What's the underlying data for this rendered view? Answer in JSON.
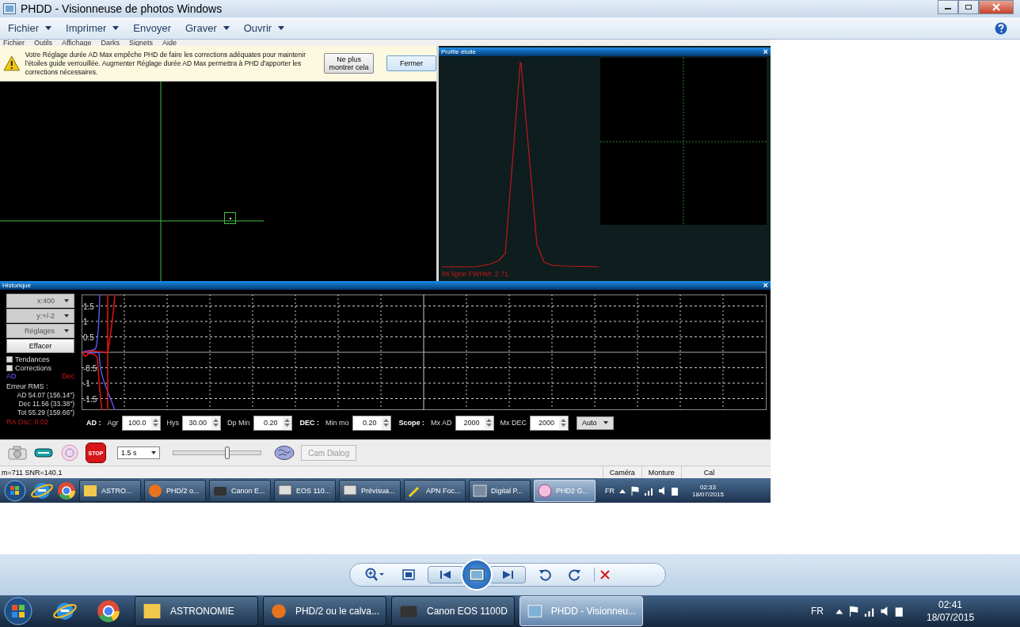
{
  "window": {
    "title": "PHDD - Visionneuse de photos Windows"
  },
  "toolbar": {
    "menus": [
      {
        "label": "Fichier",
        "has_menu": true
      },
      {
        "label": "Imprimer",
        "has_menu": true
      },
      {
        "label": "Envoyer",
        "has_menu": false
      },
      {
        "label": "Graver",
        "has_menu": true
      },
      {
        "label": "Ouvrir",
        "has_menu": true
      }
    ]
  },
  "screenshot": {
    "menu": [
      "Fichier",
      "Outils",
      "Affichage",
      "Darks",
      "Signets",
      "Aide"
    ],
    "alert": {
      "message": "Votre Réglage durée AD Max empêche PHD de faire les corrections adéquates pour maintenir l'étoiles guide verrouillée. Augmenter Réglage durée AD Max permettra à PHD d'apporter les corrections nécessaires.",
      "buttons": [
        "Ne plus montrer cela",
        "Fermer"
      ]
    },
    "profile": {
      "title": "Profile étoile",
      "close": "×",
      "readout": "Mi ligne FWHM: 2.71"
    },
    "history": {
      "title": "Historique",
      "close": "×",
      "dropdowns": [
        "x:400",
        "y:+/-2",
        "Réglages"
      ],
      "clear_button": "Effacer",
      "checkboxes": [
        {
          "label": "Tendances",
          "checked": false
        },
        {
          "label": "Corrections",
          "checked": false
        }
      ],
      "legend": {
        "ra": "AD",
        "dec": "Dec"
      },
      "rms_title": "Erreur RMS :",
      "rms": [
        "AD 54.07 (156.14\")",
        "Dec 11.56 (33.38\")",
        "Tot 55.29 (159.66\")"
      ],
      "osc": "RA Osc: 0.02",
      "yticks": [
        "1.5",
        "1",
        "0.5",
        "-0.5",
        "-1",
        "-1.5"
      ],
      "params": [
        {
          "kind": "heading",
          "text": "AD :"
        },
        {
          "kind": "spin",
          "label": "Agr",
          "value": "100.0"
        },
        {
          "kind": "spin",
          "label": "Hys",
          "value": "30.00"
        },
        {
          "kind": "spin",
          "label": "Dp Min",
          "value": "0.20"
        },
        {
          "kind": "heading",
          "text": "DEC :"
        },
        {
          "kind": "spin",
          "label": "Min mo",
          "value": "0.20"
        },
        {
          "kind": "heading",
          "text": "Scope :"
        },
        {
          "kind": "spin",
          "label": "Mx AD",
          "value": "2000"
        },
        {
          "kind": "spin",
          "label": "Mx DEC",
          "value": "2000"
        },
        {
          "kind": "select",
          "value": "Auto"
        }
      ]
    },
    "controls": {
      "stop_label": "STOP",
      "exposure": "1.5 s",
      "slider": {
        "level": 0.62
      },
      "cam_dialog": {
        "label": "Cam Dialog",
        "disabled": true
      }
    },
    "status": {
      "text": "m=711 SNR=140.1",
      "panes": [
        "Caméra",
        "Monture",
        "Cal"
      ]
    },
    "taskbar": {
      "items": [
        {
          "label": "ASTRO...",
          "selected": false
        },
        {
          "label": "PHD/2 o...",
          "selected": false
        },
        {
          "label": "Canon E...",
          "selected": false
        },
        {
          "label": "EOS 110...",
          "selected": false
        },
        {
          "label": "Prévisua...",
          "selected": false
        },
        {
          "label": "APN Foc...",
          "selected": false
        },
        {
          "label": "Digital P...",
          "selected": false
        },
        {
          "label": "PHD2 G...",
          "selected": true
        }
      ],
      "language": "FR",
      "time": "02:33",
      "date": "18/07/2015"
    }
  },
  "taskbar": {
    "items": [
      {
        "label": "ASTRONOMIE",
        "selected": false
      },
      {
        "label": "PHD/2 ou le calva...",
        "selected": false
      },
      {
        "label": "Canon EOS 1100D",
        "selected": false
      },
      {
        "label": "PHDD - Visionneu...",
        "selected": true
      }
    ],
    "language": "FR",
    "time": "02:41",
    "date": "18/07/2015"
  }
}
